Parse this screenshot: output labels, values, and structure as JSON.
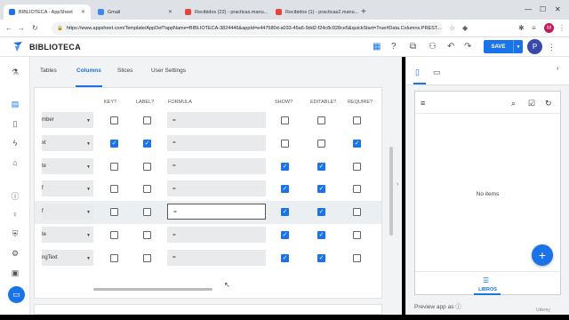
{
  "browser": {
    "tabs": [
      {
        "title": "BIBLIOTECA - AppSheet",
        "active": true,
        "fav_color": "#1a73e8"
      },
      {
        "title": "Gmail",
        "active": false,
        "fav_color": "#4285f4"
      },
      {
        "title": "Recibidos (22) - practicas.manu...",
        "active": false,
        "fav_color": "#ea4335"
      },
      {
        "title": "Recibidos (1) - practicas2.manu...",
        "active": false,
        "fav_color": "#ea4335"
      }
    ],
    "new_tab": "+",
    "url": "https://www.appsheet.com/Template/AppDef?appName=BIBLIOTECA-3824446&appId=e447580d-a033-45a6-9dd2-f24c8c928ce5&quickStart=True#Data.Columns.PREST...",
    "profile_initial": "M"
  },
  "app": {
    "title": "BIBLIOTECA",
    "save_label": "SAVE",
    "avatar_initial": "P"
  },
  "editor": {
    "tabs": [
      "Tables",
      "Columns",
      "Slices",
      "User Settings"
    ],
    "active_tab": "Columns",
    "headers": {
      "key": "KEY?",
      "label": "LABEL?",
      "formula": "FORMULA",
      "show": "SHOW?",
      "editable": "EDITABLE?",
      "require": "REQUIRE?"
    },
    "rows": [
      {
        "type": "mber",
        "key": false,
        "label": false,
        "formula": "=",
        "show": false,
        "editable": false,
        "require": false
      },
      {
        "type": "xt",
        "key": true,
        "label": true,
        "formula": "=",
        "show": false,
        "editable": false,
        "require": true
      },
      {
        "type": "te",
        "key": false,
        "label": false,
        "formula": "=",
        "show": true,
        "editable": true,
        "require": false
      },
      {
        "type": "f",
        "key": false,
        "label": false,
        "formula": "=",
        "show": true,
        "editable": true,
        "require": false
      },
      {
        "type": "f",
        "key": false,
        "label": false,
        "formula": "=",
        "show": true,
        "editable": true,
        "require": false,
        "highlight": true
      },
      {
        "type": "te",
        "key": false,
        "label": false,
        "formula": "=",
        "show": true,
        "editable": true,
        "require": false
      },
      {
        "type": "ngText",
        "key": false,
        "label": false,
        "formula": "=",
        "show": true,
        "editable": true,
        "require": false
      }
    ]
  },
  "preview": {
    "empty_text": "No items",
    "fab_label": "+",
    "nav_label": "LIBROS",
    "preview_as": "Preview app as",
    "watermark": "Udemy"
  },
  "colors": {
    "accent": "#1a73e8",
    "avatar": "#3949ab",
    "profile": "#c2185b"
  }
}
